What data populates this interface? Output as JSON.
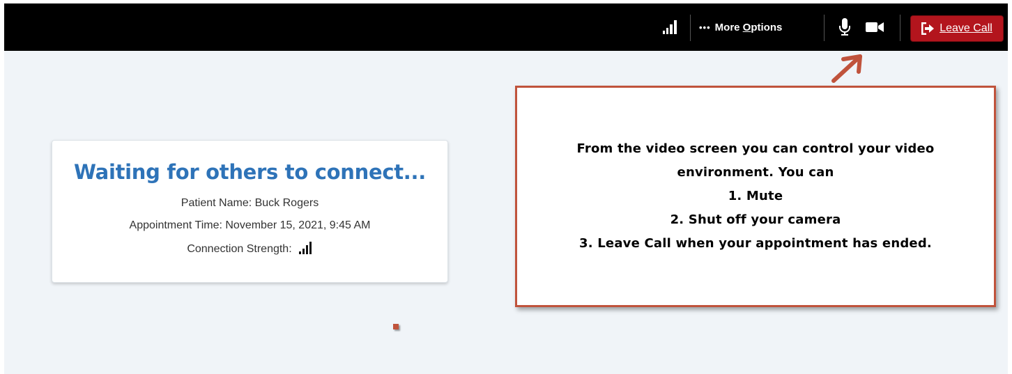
{
  "toolbar": {
    "more_dots": "•••",
    "more_pre": "More ",
    "more_ul": "O",
    "more_post": "ptions",
    "leave_label": "Leave Call",
    "signal_icon": "signal-bars-icon",
    "mic_icon": "microphone-icon",
    "camera_icon": "video-camera-icon",
    "leave_icon": "sign-out-icon",
    "leave_color": "#b3151d"
  },
  "card": {
    "title": "Waiting for others to connect...",
    "patient": "Patient Name: Buck Rogers",
    "appointment": "Appointment Time: November 15, 2021, 9:45 AM",
    "connection_label": "Connection Strength:",
    "title_color": "#2e73b8"
  },
  "annotation": {
    "lines": [
      "From the video screen you can control your video",
      "environment.  You can",
      "1. Mute",
      "2. Shut off your camera",
      "3. Leave Call when your appointment has ended."
    ],
    "border_color": "#c0533c"
  }
}
